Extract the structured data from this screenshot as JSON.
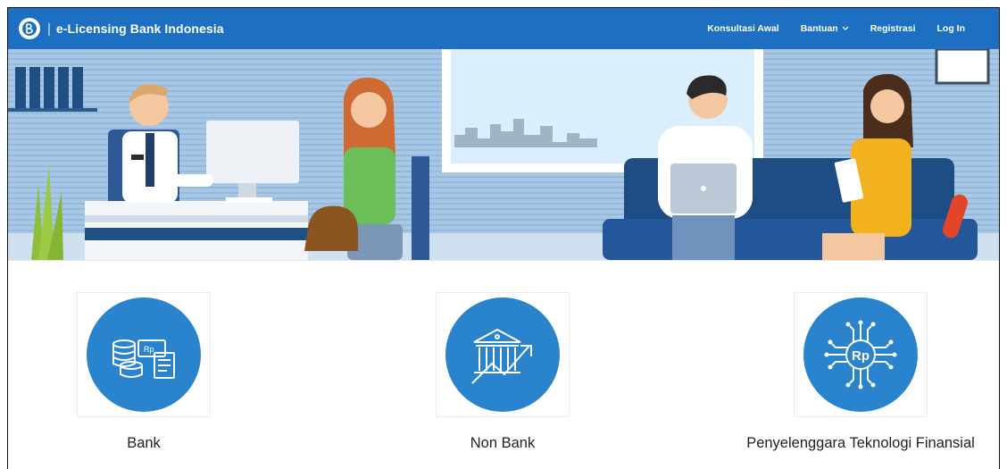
{
  "navbar": {
    "brand_separator": "|",
    "brand_name": "e-Licensing Bank Indonesia",
    "brand_logo_icon": "bank-indonesia-logo-icon",
    "links": [
      {
        "label": "Konsultasi Awal"
      },
      {
        "label": "Bantuan",
        "has_dropdown": true
      },
      {
        "label": "Registrasi"
      },
      {
        "label": "Log In"
      }
    ]
  },
  "categories": [
    {
      "label": "Bank",
      "icon": "bank-coins-documents-icon"
    },
    {
      "label": "Non Bank",
      "icon": "building-growth-chart-icon"
    },
    {
      "label": "Penyelenggara Teknologi Finansial",
      "icon": "rupiah-circuit-icon",
      "icon_text": "Rp"
    }
  ],
  "colors": {
    "navbar": "#1d6fc1",
    "category_circle": "#2a84cd",
    "hero_wall": "#a6c6e4"
  }
}
